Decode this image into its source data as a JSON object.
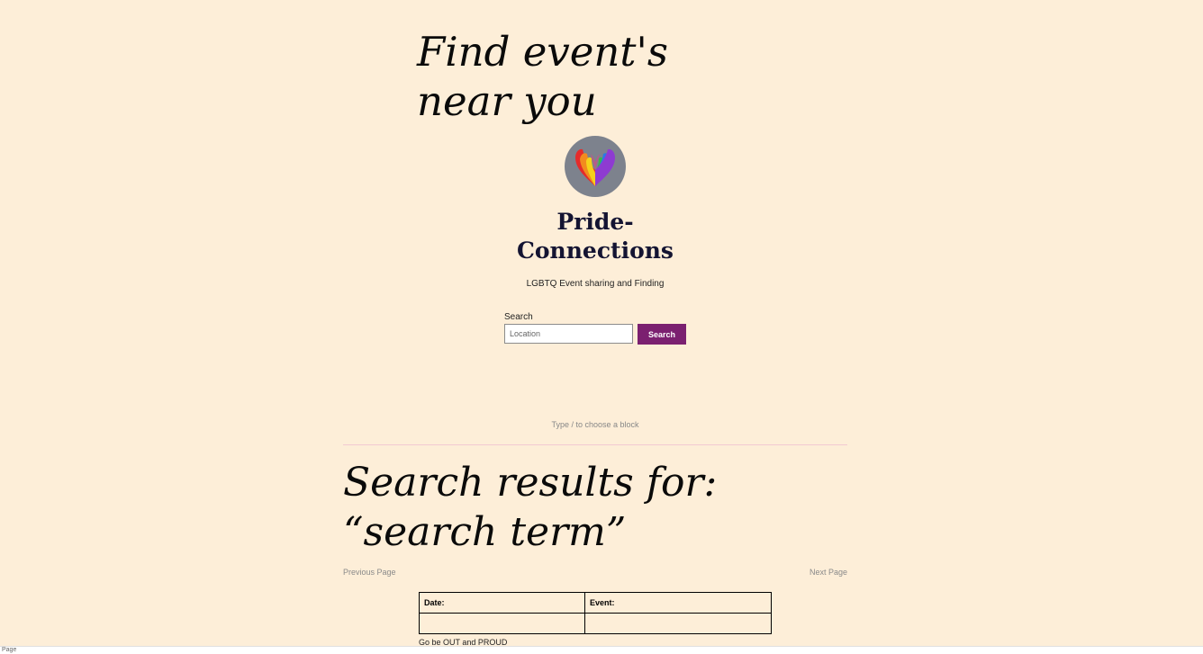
{
  "hero": {
    "title": "Find event's near you"
  },
  "site": {
    "logo_icon": "rainbow-heart-icon",
    "title": "Pride-Connections",
    "tagline": "LGBTQ Event sharing and Finding"
  },
  "search": {
    "label": "Search",
    "placeholder": "Location",
    "button_label": "Search",
    "button_color": "#7b2070"
  },
  "editor": {
    "block_hint": "Type / to choose a block"
  },
  "results": {
    "title": "Search results for: “search term”",
    "previous_label": "Previous Page",
    "next_label": "Next Page"
  },
  "table": {
    "headers": [
      "Date:",
      "Event:"
    ],
    "rows": [
      [
        "",
        ""
      ]
    ]
  },
  "footer": {
    "note": "Go be OUT and PROUD"
  },
  "status_bar": {
    "text": "Page"
  },
  "colors": {
    "background": "#fdeed8",
    "logo_circle": "#7d828d",
    "site_title": "#141432",
    "divider": "#f2c9d2"
  }
}
